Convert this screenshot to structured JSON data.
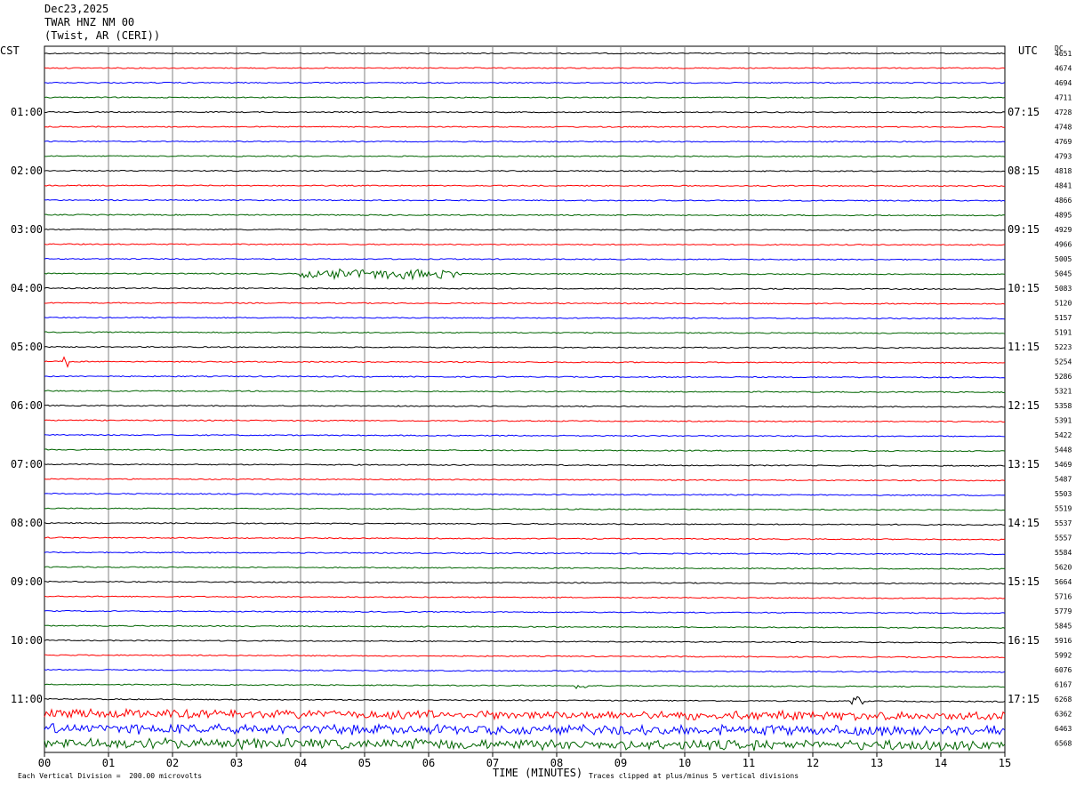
{
  "header": {
    "date": "Dec23,2025",
    "station": "TWAR HNZ NM 00",
    "location": "(Twist, AR (CERI))"
  },
  "labels": {
    "left_zone": "CST",
    "right_zone": "UTC",
    "dc_label": "DC",
    "xlabel": "TIME (MINUTES)",
    "scale_note": "Each Vertical Division =  200.00 microvolts",
    "clip_note": "Traces clipped at plus/minus 5 vertical divisions"
  },
  "chart_data": {
    "type": "line",
    "title": "TWAR HNZ NM 00",
    "xlabel": "TIME (MINUTES)",
    "xlim": [
      0,
      15
    ],
    "x_ticks": [
      "00",
      "01",
      "02",
      "03",
      "04",
      "05",
      "06",
      "07",
      "08",
      "09",
      "10",
      "11",
      "12",
      "13",
      "14",
      "15"
    ],
    "left_hour_labels": [
      "01:00",
      "02:00",
      "03:00",
      "04:00",
      "05:00",
      "06:00",
      "07:00",
      "08:00",
      "09:00",
      "10:00",
      "11:00"
    ],
    "right_hour_labels": [
      "07:15",
      "08:15",
      "09:15",
      "10:15",
      "11:15",
      "12:15",
      "13:15",
      "14:15",
      "15:15",
      "16:15",
      "17:15"
    ],
    "dc_offsets": [
      "4651",
      "4674",
      "4694",
      "4711",
      "4728",
      "4748",
      "4769",
      "4793",
      "4818",
      "4841",
      "4866",
      "4895",
      "4929",
      "4966",
      "5005",
      "5045",
      "5083",
      "5120",
      "5157",
      "5191",
      "5223",
      "5254",
      "5286",
      "5321",
      "5358",
      "5391",
      "5422",
      "5448",
      "5469",
      "5487",
      "5503",
      "5519",
      "5537",
      "5557",
      "5584",
      "5620",
      "5664",
      "5716",
      "5779",
      "5845",
      "5916",
      "5992",
      "6076",
      "6167",
      "6268",
      "6362",
      "6463",
      "6568"
    ],
    "trace_colors": [
      "#000000",
      "#ff0000",
      "#0000ff",
      "#006400"
    ],
    "trace_count": 48,
    "traces_per_hour": 4,
    "minutes_per_trace": 15,
    "events": [
      {
        "trace": 15,
        "start_min": 4.0,
        "end_min": 6.5,
        "amplitude": 0.7
      },
      {
        "trace": 21,
        "start_min": 0.3,
        "end_min": 0.4,
        "amplitude": 0.8
      },
      {
        "trace": 43,
        "start_min": 8.3,
        "end_min": 8.5,
        "amplitude": 0.5
      },
      {
        "trace": 44,
        "start_min": 12.6,
        "end_min": 12.8,
        "amplitude": 0.6
      },
      {
        "trace": 45,
        "start_min": 0.0,
        "end_min": 15.0,
        "amplitude": 0.6
      },
      {
        "trace": 46,
        "start_min": 0.0,
        "end_min": 15.0,
        "amplitude": 0.7
      },
      {
        "trace": 47,
        "start_min": 0.0,
        "end_min": 15.0,
        "amplitude": 0.7
      }
    ]
  }
}
